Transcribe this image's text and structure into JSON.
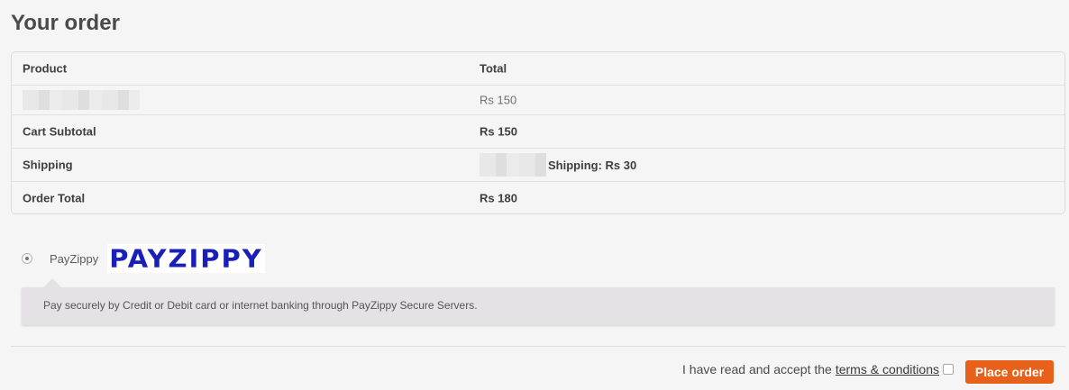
{
  "heading": "Your order",
  "table": {
    "col_product": "Product",
    "col_total": "Total",
    "item_total": "Rs 150",
    "subtotal_label": "Cart Subtotal",
    "subtotal_value": "Rs 150",
    "shipping_label": "Shipping",
    "shipping_value": "Shipping: Rs 30",
    "order_total_label": "Order Total",
    "order_total_value": "Rs 180"
  },
  "payment": {
    "method_label": "PayZippy",
    "logo_text": "PAYZIPPY",
    "description": "Pay securely by Credit or Debit card or internet banking through PayZippy Secure Servers.",
    "selected": true
  },
  "footer": {
    "accept_text": "I have read and accept the",
    "terms_link": "terms & conditions",
    "place_order": "Place order"
  },
  "colors": {
    "button": "#e8611a",
    "logo": "#1a1fb8"
  }
}
